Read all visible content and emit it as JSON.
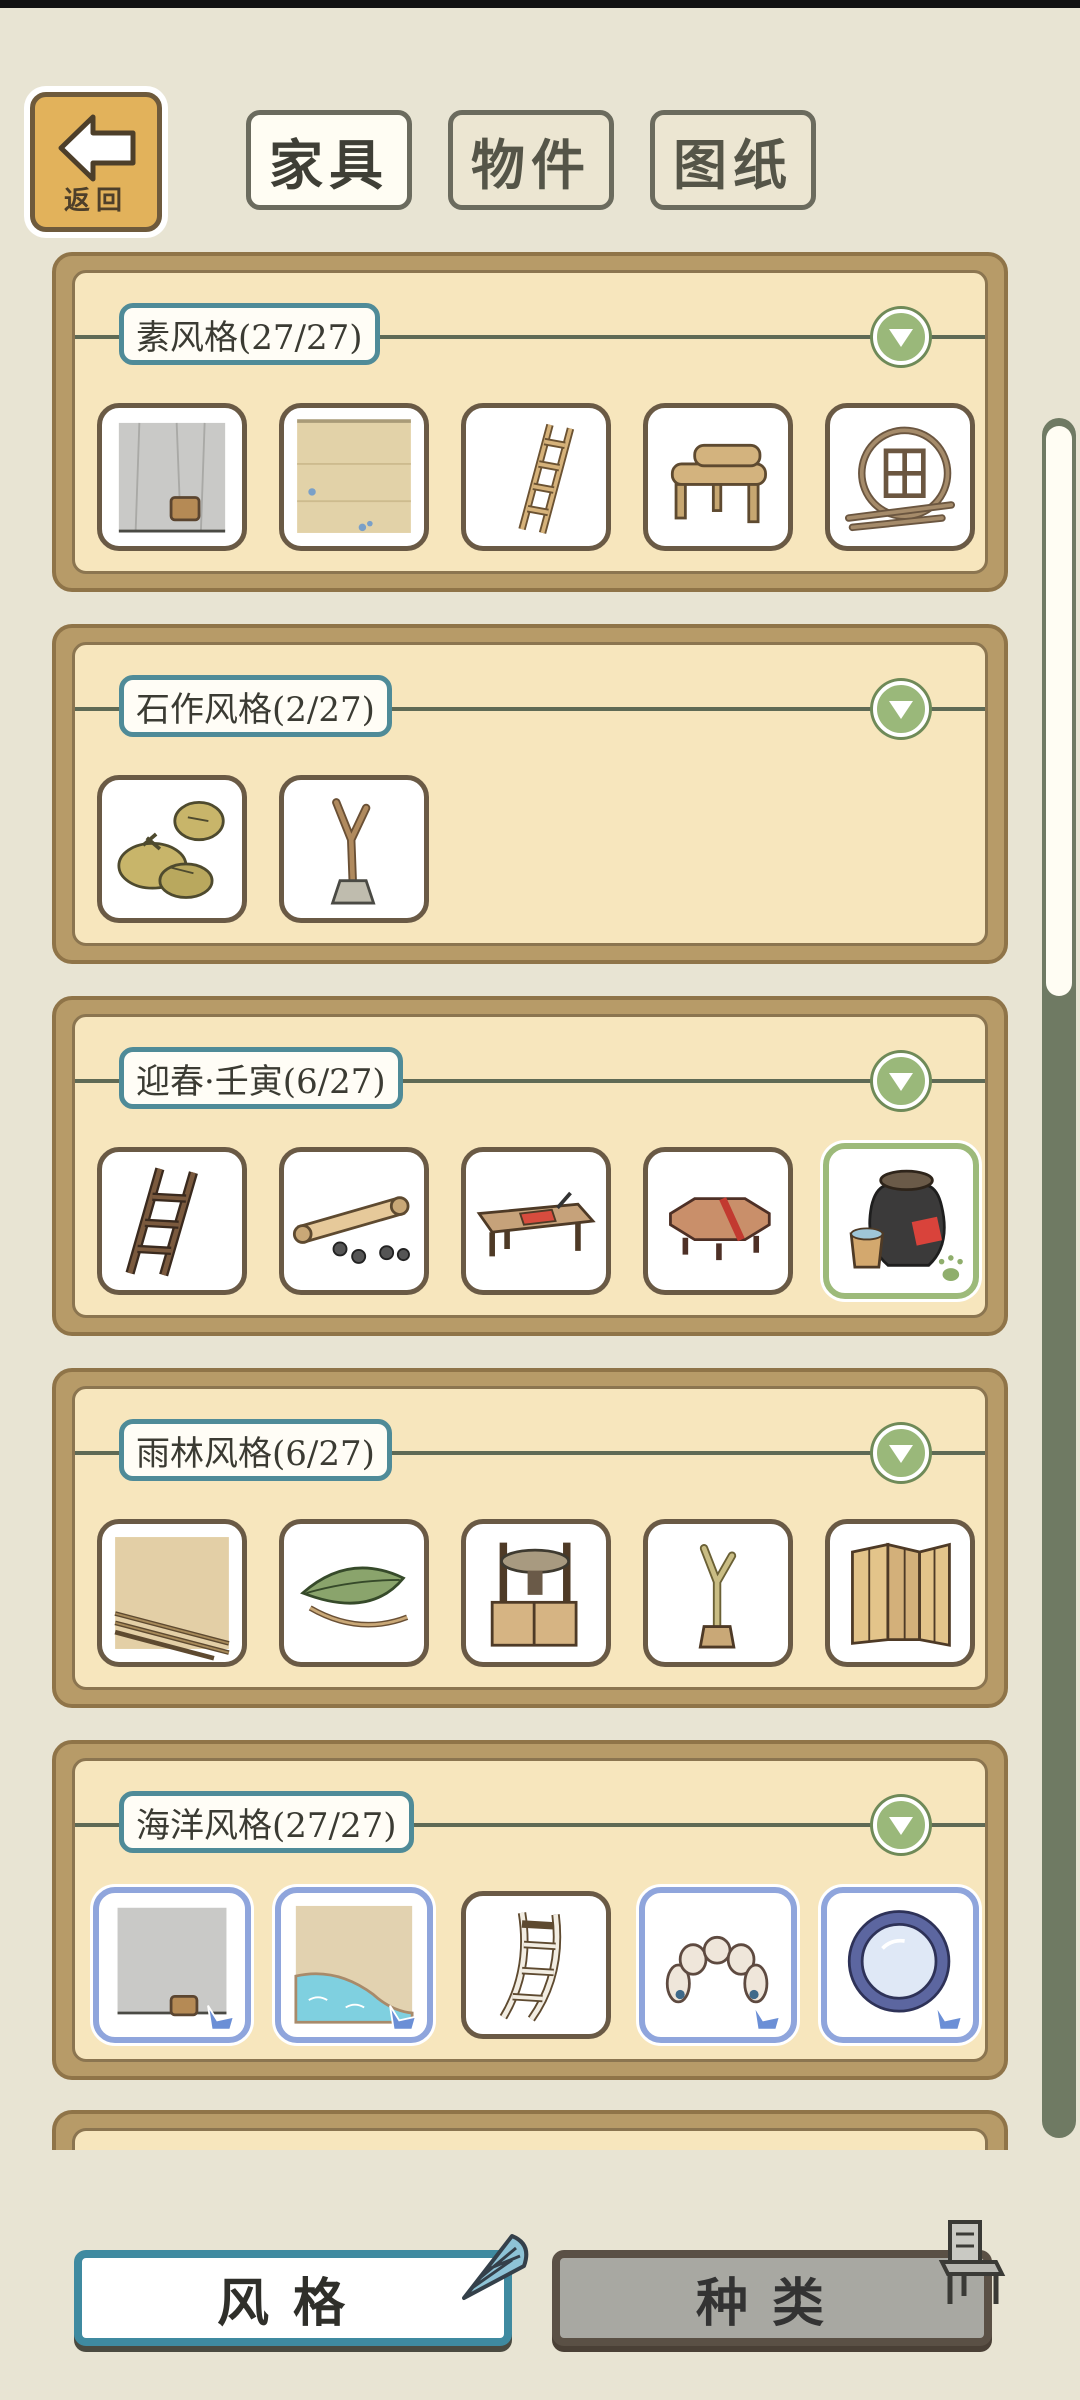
{
  "header": {
    "back_label": "返回",
    "tabs": [
      {
        "label": "家具",
        "active": true
      },
      {
        "label": "物件",
        "active": false
      },
      {
        "label": "图纸",
        "active": false
      }
    ]
  },
  "sections": [
    {
      "title": "素风格(27/27)",
      "items": [
        "wall-panel",
        "floor-panel",
        "wooden-ladder",
        "log-bench",
        "round-window"
      ]
    },
    {
      "title": "石作风格(2/27)",
      "items": [
        "leaf-plates",
        "branch-stand"
      ]
    },
    {
      "title": "迎春·壬寅(6/27)",
      "items": [
        "dark-ladder",
        "scroll-and-coins",
        "fortune-desk",
        "octagon-table",
        "wine-jar-selected"
      ]
    },
    {
      "title": "雨林风格(6/27)",
      "items": [
        "bamboo-floor",
        "leaf-hammock",
        "stone-mill-cabinet",
        "branch-stand",
        "bamboo-screen"
      ]
    },
    {
      "title": "海洋风格(27/27)",
      "items": [
        "sea-wall",
        "sea-pool-floor",
        "white-ladder",
        "shell-arch",
        "porthole-mirror"
      ]
    }
  ],
  "bottom": {
    "style_label": "风格",
    "kind_label": "种类"
  },
  "colors": {
    "section_frame": "#b79b68",
    "section_inner": "#f7e6bd",
    "title_border": "#4f8b98",
    "toggle": "#9ab87a",
    "selected_green": "#9dba7a",
    "owned_blue": "#8fa5dc"
  }
}
